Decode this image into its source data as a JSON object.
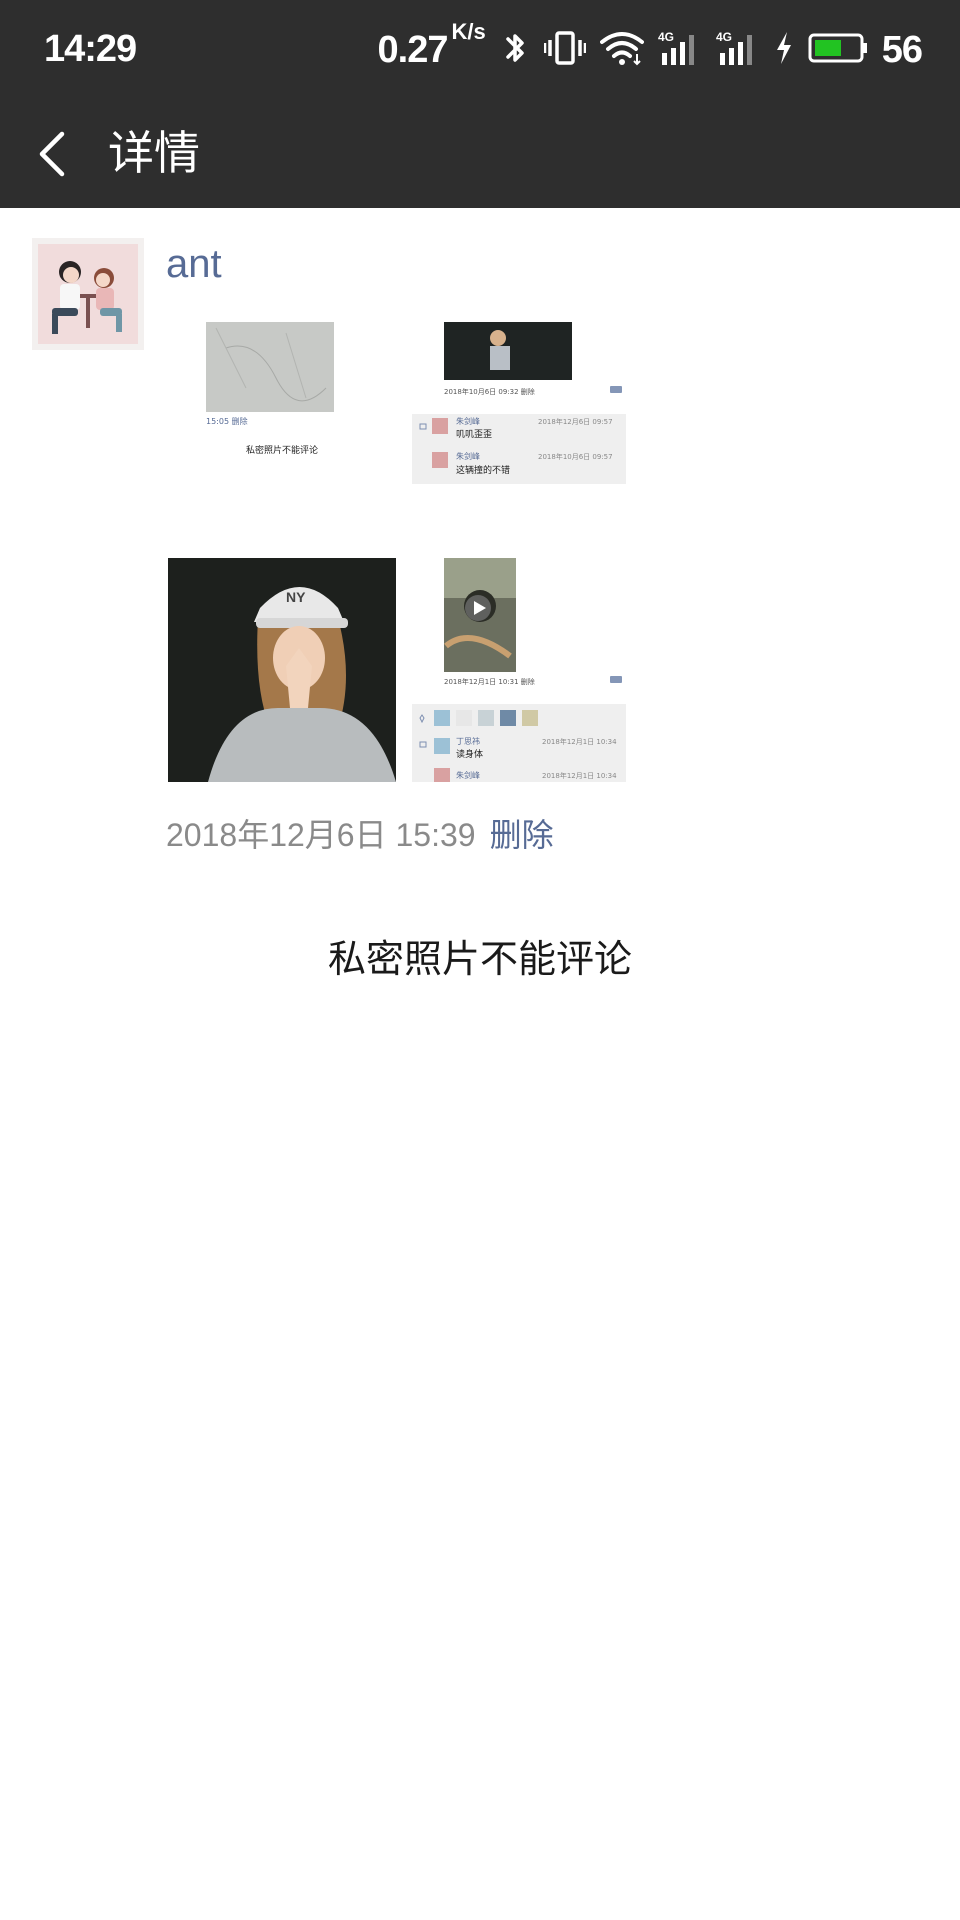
{
  "status_bar": {
    "time": "14:29",
    "net_speed": "0.27",
    "net_unit": "K/s",
    "network_1": "4G",
    "network_2": "4G",
    "battery_level": "56",
    "icons": [
      "bluetooth-icon",
      "vibrate-icon",
      "wifi-icon",
      "signal-4g-icon",
      "signal-4g-icon",
      "charging-icon",
      "battery-icon"
    ]
  },
  "header": {
    "title": "详情",
    "back_icon": "chevron-left-icon"
  },
  "post": {
    "username": "ant",
    "timestamp": "2018年12月6日 15:39",
    "delete_label": "删除",
    "note": "私密照片不能评论",
    "photos": [
      {
        "kind": "screenshot",
        "caption_small": "15:05 删除",
        "caption_main": "私密照片不能评论"
      },
      {
        "kind": "screenshot",
        "timestamp_small": "2018年10月6日 09:32 删除",
        "comments": [
          {
            "name": "朱剑峰",
            "time": "2018年12月6日 09:57",
            "text": "叽叽歪歪"
          },
          {
            "name": "朱剑峰",
            "time": "2018年10月6日 09:57",
            "text": "这辆撞的不错"
          }
        ]
      },
      {
        "kind": "photo",
        "description_icon": "portrait-photo"
      },
      {
        "kind": "screenshot",
        "timestamp_small": "2018年12月1日 10:31 删除",
        "comments": [
          {
            "name": "丁思祎",
            "time": "2018年12月1日 10:34",
            "text": "读身体"
          },
          {
            "name": "朱剑峰",
            "time": "2018年12月1日 10:36",
            "text": ""
          }
        ]
      }
    ]
  },
  "colors": {
    "bar_bg": "#2e2e2e",
    "link": "#576b95",
    "meta": "#888888",
    "battery_fill": "#22c322"
  }
}
